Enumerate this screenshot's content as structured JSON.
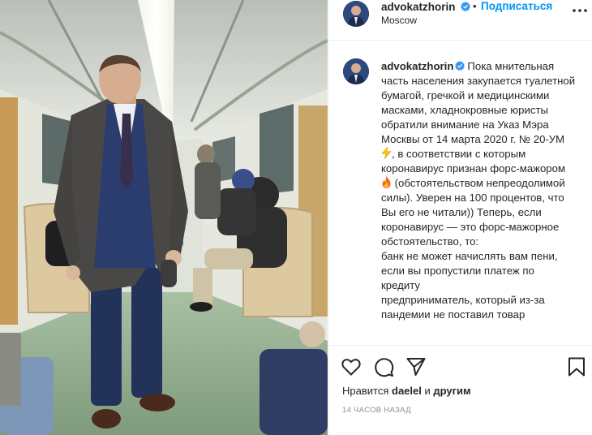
{
  "header": {
    "username": "advokatzhorin",
    "location": "Moscow",
    "separator": "•",
    "follow_label": "Подписаться"
  },
  "caption": {
    "username": "advokatzhorin",
    "segments": [
      "Пока мнительная часть населения закупается туалетной бумагой, гречкой и медицинскими масками, хладнокровные юристы обратили внимание на Указ Мэра Москвы от 14 марта 2020 г. № 20-УМ",
      ", в соответствии с которым коронавирус признан форс-мажором",
      " (обстоятельством непреодолимой силы). Уверен на 100 процентов, что Вы его не читали)) Теперь, если коронавирус — это форс-мажорное обстоятельство, то:",
      "банк не может начислять вам пени, если вы пропустили платеж по кредиту",
      "предприниматель, который из-за пандемии не поставил товар"
    ],
    "emoji": [
      "lightning-bolt-emoji",
      "fire-emoji"
    ]
  },
  "actions": {
    "icons": [
      "heart-icon",
      "comment-icon",
      "share-icon",
      "bookmark-icon"
    ],
    "likes_prefix": "Нравится",
    "likes_user": "daelel",
    "likes_and": "и",
    "likes_others": "другим",
    "time_ago": "14 ЧАСОВ НАЗАД"
  },
  "photo": {
    "description_icon": "post-photo"
  },
  "colors": {
    "follow": "#0095f6",
    "verified": "#3897f0",
    "text": "#262626",
    "muted": "#8e8e8e",
    "border": "#efefef"
  }
}
